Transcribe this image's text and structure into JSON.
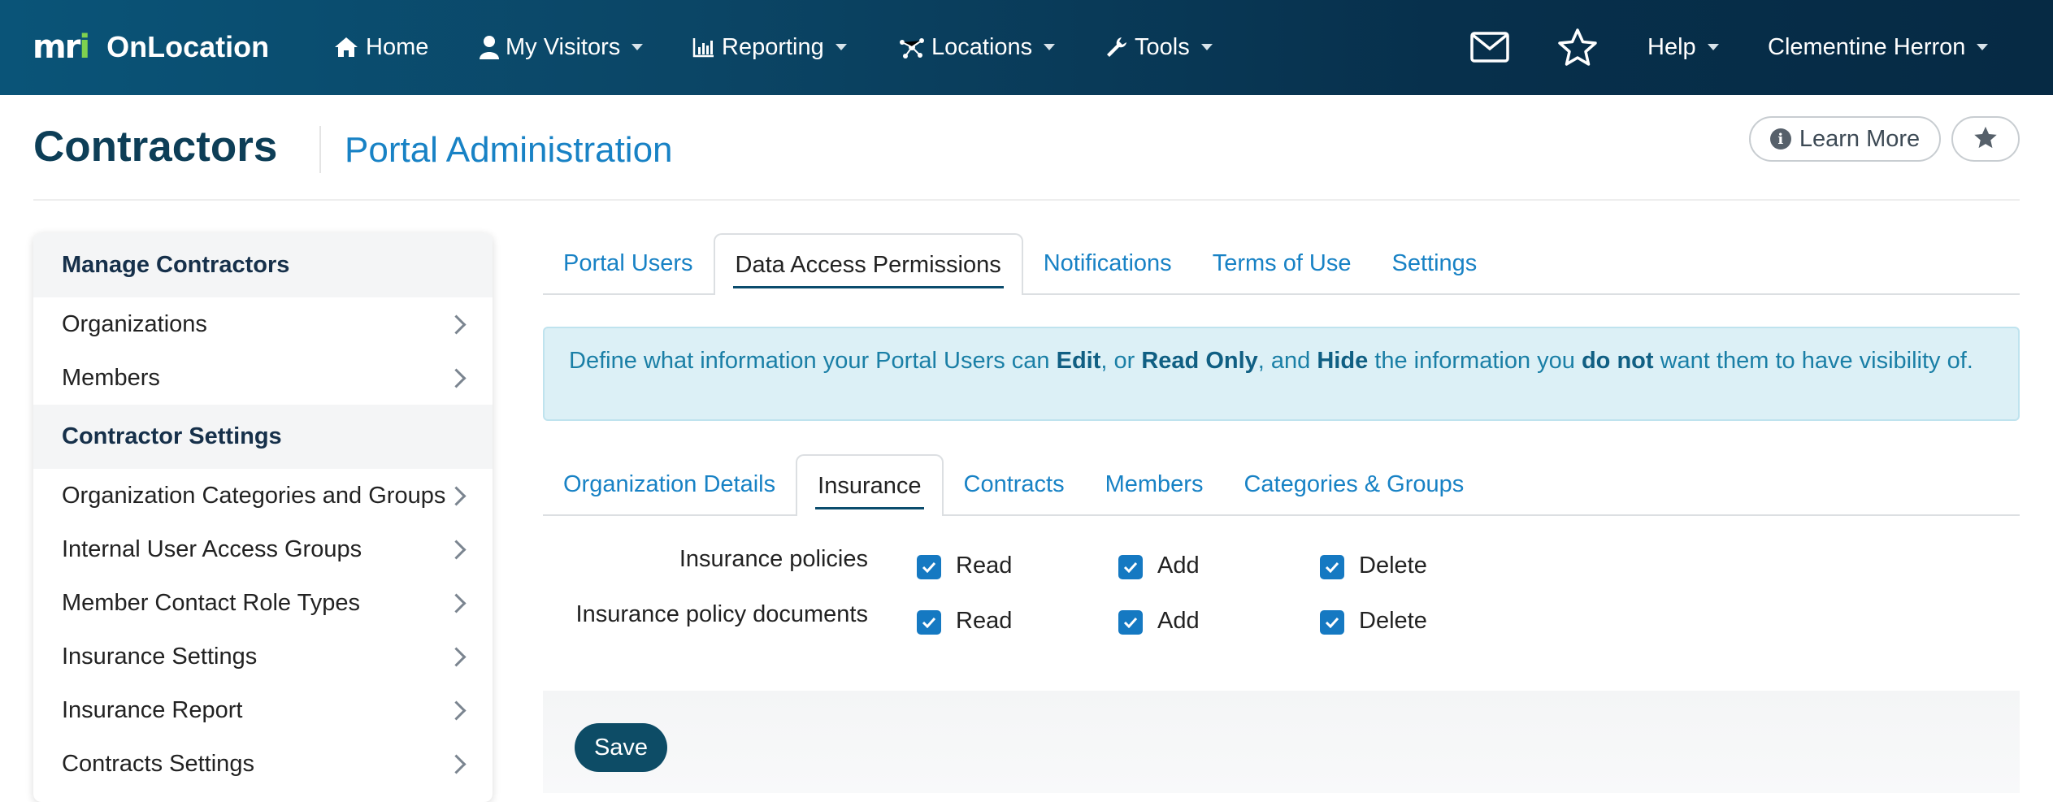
{
  "brand": {
    "logo_text": "mri",
    "product": "OnLocation"
  },
  "nav": {
    "home": "Home",
    "visitors": "My Visitors",
    "reporting": "Reporting",
    "locations": "Locations",
    "tools": "Tools",
    "help": "Help",
    "user": "Clementine Herron",
    "icons": [
      "home-icon",
      "user-icon",
      "bar-chart-icon",
      "network-icon",
      "wrench-icon",
      "mail-icon",
      "star-icon"
    ]
  },
  "header": {
    "title": "Contractors",
    "subtitle": "Portal Administration",
    "learn_more": "Learn More"
  },
  "sidebar": {
    "section1": "Manage Contractors",
    "section1_items": [
      "Organizations",
      "Members"
    ],
    "section2": "Contractor Settings",
    "section2_items": [
      "Organization Categories and Groups",
      "Internal User Access Groups",
      "Member Contact Role Types",
      "Insurance Settings",
      "Insurance Report",
      "Contracts Settings"
    ]
  },
  "main_tabs": {
    "items": [
      "Portal Users",
      "Data Access Permissions",
      "Notifications",
      "Terms of Use",
      "Settings"
    ],
    "active": "Data Access Permissions"
  },
  "info": {
    "p1": "Define what information your Portal Users can ",
    "edit": "Edit",
    "p2": ", or ",
    "read_only": "Read Only",
    "p3": ", and ",
    "hide": "Hide",
    "p4": " the information you ",
    "do_not": "do not",
    "p5": " want them to have visibility of."
  },
  "sub_tabs": {
    "items": [
      "Organization Details",
      "Insurance",
      "Contracts",
      "Members",
      "Categories & Groups"
    ],
    "active": "Insurance"
  },
  "permissions": {
    "rows": [
      {
        "label": "Insurance policies",
        "read": "Read",
        "add": "Add",
        "delete": "Delete",
        "read_checked": true,
        "add_checked": true,
        "delete_checked": true
      },
      {
        "label": "Insurance policy documents",
        "read": "Read",
        "add": "Add",
        "delete": "Delete",
        "read_checked": true,
        "add_checked": true,
        "delete_checked": true
      }
    ]
  },
  "actions": {
    "save": "Save"
  },
  "colors": {
    "nav_bg": "#0b4565",
    "accent": "#1882c5",
    "checkbox": "#1579c2",
    "save": "#0d4c66",
    "logo_accent": "#7fd14f"
  }
}
